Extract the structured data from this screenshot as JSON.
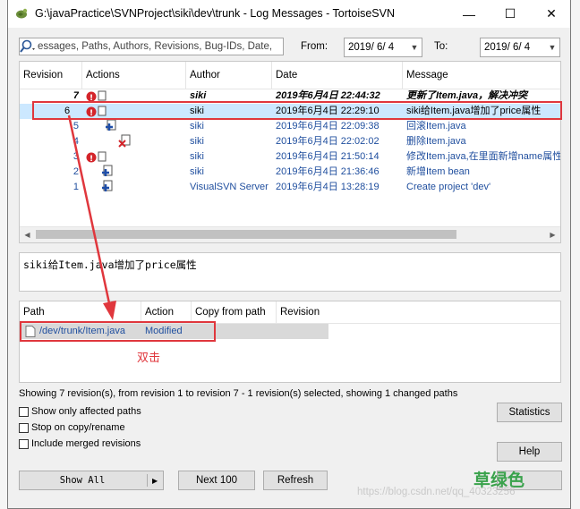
{
  "window": {
    "title": "G:\\javaPractice\\SVNProject\\siki\\dev\\trunk - Log Messages - TortoiseSVN",
    "minimize": "—",
    "maximize": "☐",
    "close": "✕"
  },
  "filter": {
    "search_placeholder": "essages, Paths, Authors, Revisions, Bug-IDs, Date,",
    "from_label": "From:",
    "from_date": "2019/ 6/ 4",
    "to_label": "To:",
    "to_date": "2019/ 6/ 4"
  },
  "log": {
    "columns": [
      "Revision",
      "Actions",
      "Author",
      "Date",
      "Message"
    ],
    "rows": [
      {
        "revision": "7",
        "author": "siki",
        "date": "2019年6月4日 22:44:32",
        "message": "更新了Item.java，解决冲突"
      },
      {
        "revision": "6",
        "author": "siki",
        "date": "2019年6月4日 22:29:10",
        "message": "siki给Item.java增加了price属性"
      },
      {
        "revision": "5",
        "author": "siki",
        "date": "2019年6月4日 22:09:38",
        "message": "回滚Item.java"
      },
      {
        "revision": "4",
        "author": "siki",
        "date": "2019年6月4日 22:02:02",
        "message": "删除Item.java"
      },
      {
        "revision": "3",
        "author": "siki",
        "date": "2019年6月4日 21:50:14",
        "message": "修改Item.java,在里面新增name属性"
      },
      {
        "revision": "2",
        "author": "siki",
        "date": "2019年6月4日 21:36:46",
        "message": "新增Item bean"
      },
      {
        "revision": "1",
        "author": "VisualSVN Server",
        "date": "2019年6月4日 13:28:19",
        "message": "Create project 'dev'"
      }
    ]
  },
  "message_text": "siki给Item.java增加了price属性",
  "paths": {
    "columns": [
      "Path",
      "Action",
      "Copy from path",
      "Revision"
    ],
    "rows": [
      {
        "path": "/dev/trunk/Item.java",
        "action": "Modified"
      }
    ]
  },
  "annotation": "双击",
  "status_text": "Showing 7 revision(s), from revision 1 to revision 7 - 1 revision(s) selected, showing 1 changed paths",
  "options": {
    "affected": "Show only affected paths",
    "stop": "Stop on copy/rename",
    "merged": "Include merged revisions"
  },
  "buttons": {
    "statistics": "Statistics",
    "help": "Help",
    "show_all": "Show All",
    "next100": "Next 100",
    "refresh": "Refresh"
  },
  "watermark": {
    "green_text": "草绿色",
    "url": "https://blog.csdn.net/qq_40323256"
  },
  "colors": {
    "selection": "#cce8ff",
    "highlight_red": "#e0373d",
    "link_blue": "#1f4e9e",
    "watermark_green": "#3aa24c"
  }
}
